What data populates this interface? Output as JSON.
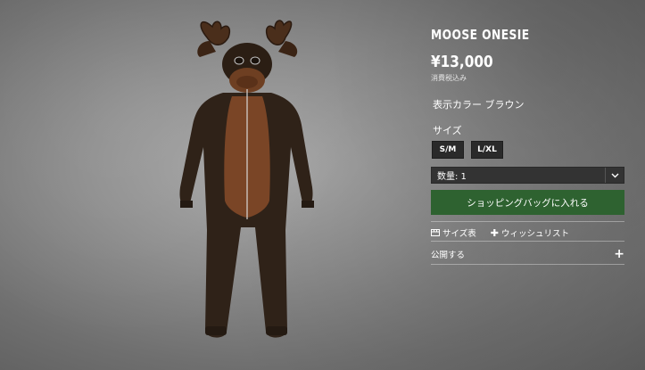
{
  "product": {
    "title": "MOOSE ONESIE",
    "price": "¥13,000",
    "tax_note": "消費税込み",
    "color_line": "表示カラー ブラウン",
    "size_heading": "サイズ",
    "sizes": [
      "S/M",
      "L/XL"
    ],
    "quantity_text": "数量: 1",
    "add_to_cart_label": "ショッピングバッグに入れる",
    "size_chart_label": "サイズ表",
    "wishlist_label": "ウィッシュリスト",
    "publish_label": "公開する",
    "publish_toggle": "+"
  },
  "colors": {
    "cart_button": "#2e6230",
    "size_button": "#2a2a2a",
    "onesie_dark": "#2f2218",
    "onesie_panel": "#7a4526"
  }
}
